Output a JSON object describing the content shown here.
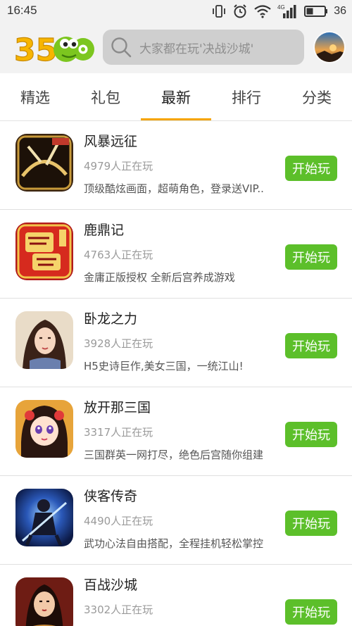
{
  "status_bar": {
    "time": "16:45",
    "network_label": "4G",
    "battery_level": "36",
    "icons": [
      "vibrate-icon",
      "alarm-icon",
      "wifi-icon",
      "signal-icon",
      "battery-icon"
    ]
  },
  "header": {
    "logo_text": "3500",
    "search_placeholder": "大家都在玩'决战沙城'"
  },
  "tabs": [
    {
      "label": "精选",
      "active": false
    },
    {
      "label": "礼包",
      "active": false
    },
    {
      "label": "最新",
      "active": true
    },
    {
      "label": "排行",
      "active": false
    },
    {
      "label": "分类",
      "active": false
    }
  ],
  "games": [
    {
      "title": "风暴远征",
      "players": "4979人正在玩",
      "desc": "顶级酷炫画面，超萌角色，登录送VIP..",
      "button": "开始玩",
      "icon": "fengbao-game-icon"
    },
    {
      "title": "鹿鼎记",
      "players": "4763人正在玩",
      "desc": "金庸正版授权 全新后宫养成游戏",
      "button": "开始玩",
      "icon": "ludingji-game-icon"
    },
    {
      "title": "卧龙之力",
      "players": "3928人正在玩",
      "desc": "H5史诗巨作,美女三国，一统江山!",
      "button": "开始玩",
      "icon": "wolong-game-icon"
    },
    {
      "title": "放开那三国",
      "players": "3317人正在玩",
      "desc": "三国群英一网打尽，绝色后宫随你组建",
      "button": "开始玩",
      "icon": "fangkai-game-icon"
    },
    {
      "title": "侠客传奇",
      "players": "4490人正在玩",
      "desc": "武功心法自由搭配，全程挂机轻松掌控",
      "button": "开始玩",
      "icon": "xiake-game-icon"
    },
    {
      "title": "百战沙城",
      "players": "3302人正在玩",
      "desc": "",
      "button": "开始玩",
      "icon": "baizhan-game-icon"
    }
  ],
  "colors": {
    "accent_orange": "#f5a400",
    "play_green": "#5cbf2a",
    "logo_yellow": "#f7b500",
    "logo_green": "#7cc61f"
  }
}
